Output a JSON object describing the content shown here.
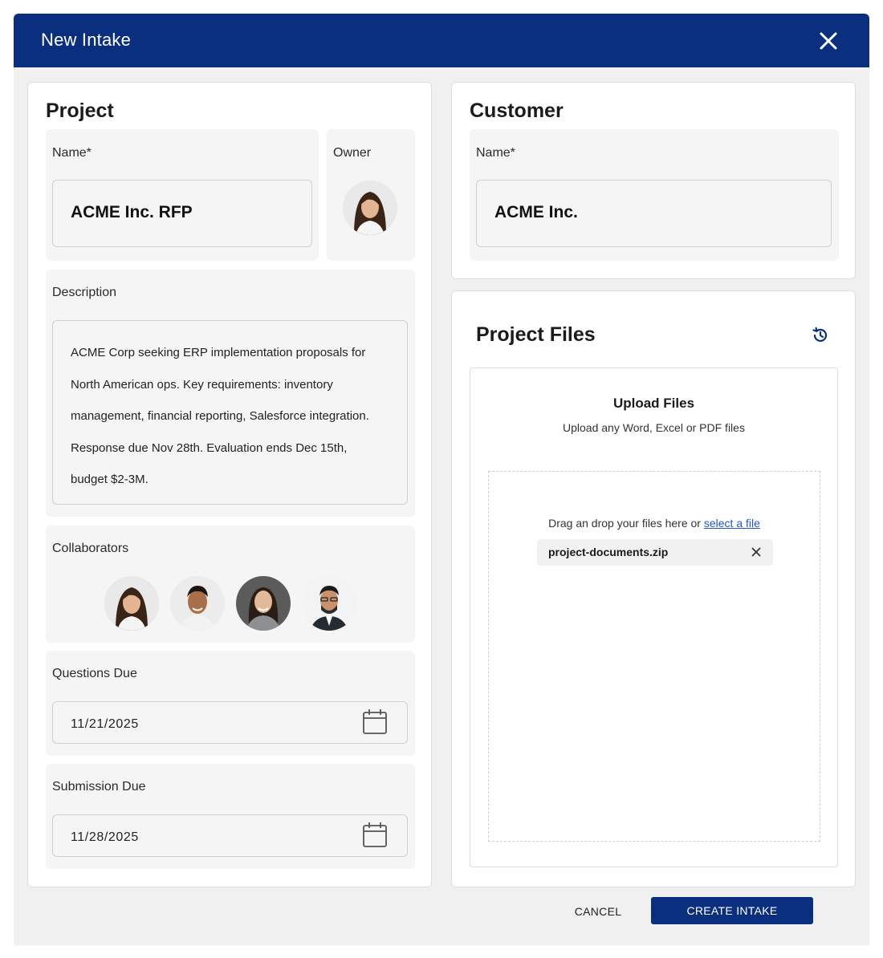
{
  "modal": {
    "title": "New Intake",
    "close_icon": "close-icon"
  },
  "project": {
    "title": "Project",
    "name_label": "Name*",
    "name_value": "ACME Inc. RFP",
    "owner_label": "Owner",
    "description_label": "Description",
    "description_lines": [
      "ACME Corp seeking ERP implementation proposals for",
      "North American ops. Key requirements: inventory",
      "management, financial reporting, Salesforce integration.",
      "Response due Nov 28th. Evaluation ends Dec 15th,",
      "budget $2-3M."
    ],
    "collaborators_label": "Collaborators",
    "questions_due_label": "Questions Due",
    "questions_due_value": "11/21/2025",
    "submission_due_label": "Submission Due",
    "submission_due_value": "11/28/2025"
  },
  "customer": {
    "title": "Customer",
    "name_label": "Name*",
    "name_value": "ACME Inc."
  },
  "files": {
    "title": "Project Files",
    "history_icon": "history-icon",
    "upload_title": "Upload Files",
    "upload_subtitle": "Upload any Word, Excel or PDF files",
    "drop_text": "Drag an drop your files here or",
    "select_link": "select a file",
    "file_name": "project-documents.zip"
  },
  "actions": {
    "cancel": "CANCEL",
    "create": "CREATE INTAKE"
  },
  "colors": {
    "brand": "#0b2f7f",
    "link": "#1f56c4",
    "panel": "#f5f5f5"
  }
}
